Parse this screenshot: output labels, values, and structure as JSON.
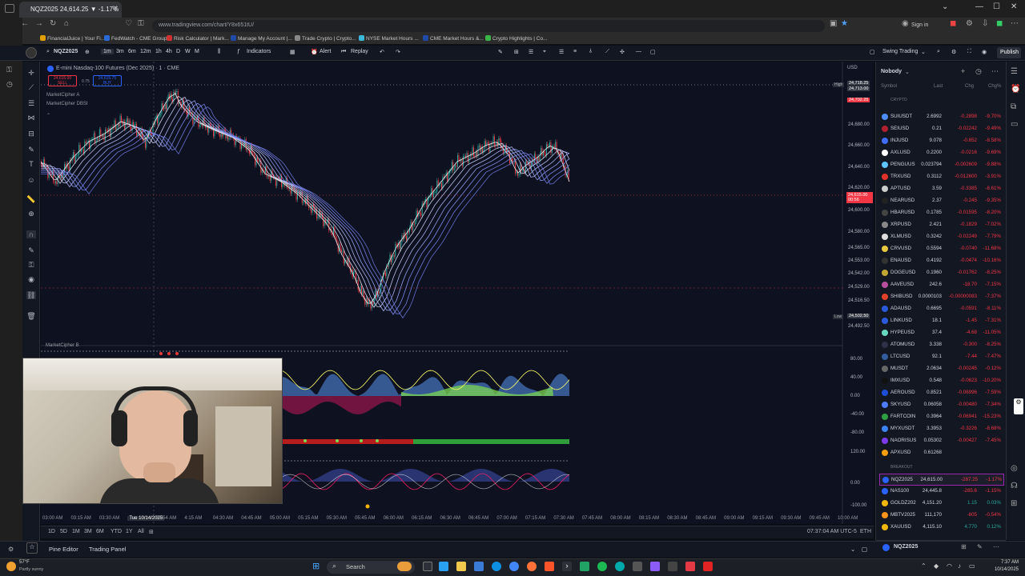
{
  "browser": {
    "tab_title": "NQZ2025 24,614.25 ▼ -1.17%",
    "url": "www.tradingview.com/chart/Y8x651tU/",
    "sign_in": "Sign in",
    "bookmarks": [
      "FinancialJuice | Your Fi...",
      "FedWatch - CME Group",
      "Risk Calculator | Mark...",
      "Manage My Account |...",
      "Trade Crypto | Crypto...",
      "NYSE Market Hours ...",
      "CME Market Hours &...",
      "Crypto Highlights | Co..."
    ]
  },
  "header": {
    "symbol": "NQZ2025",
    "intervals": [
      "1m",
      "3m",
      "6m",
      "12m",
      "1h",
      "4h",
      "D",
      "W",
      "M"
    ],
    "indicators_label": "Indicators",
    "alert_label": "Alert",
    "replay_label": "Replay",
    "layout_name": "Swing Trading",
    "publish_label": "Publish"
  },
  "chart": {
    "title": "E-mini Nasdaq-100 Futures (Dec 2025) · 1 · CME",
    "sell_price": "24,615.00",
    "sell_label": "SELL",
    "spread": "0.75",
    "buy_price": "24,615.75",
    "buy_label": "BUY",
    "indicator_a": "MarketCipher A",
    "indicator_dbsi": "MarketCipher DBSI",
    "indicator_b": "MarketCipher B",
    "currency": "USD",
    "price_labels": [
      "24,680.00",
      "24,660.00",
      "24,640.00",
      "24,620.00",
      "24,600.00",
      "24,580.00",
      "24,565.00",
      "24,553.00",
      "24,542.00",
      "24,529.00",
      "24,516.50",
      "24,492.50"
    ],
    "high_label": "High",
    "high_value": "24,718.25",
    "high_value2": "24,713.00",
    "current_price": "24,702.25",
    "last_price": "24,615.00",
    "last_countdown": "00:56",
    "low_label": "Low",
    "low_value": "24,502.50",
    "osc_labels": [
      "80.00",
      "40.00",
      "0.00",
      "-40.00",
      "-80.00",
      "120.00",
      "0.00",
      "-100.00"
    ],
    "time_labels": [
      "03:00 AM",
      "03:15 AM",
      "03:30 AM",
      "Tue 10/14/2025",
      "03:54 AM",
      "4:15 AM",
      "04:30 AM",
      "04:45 AM",
      "05:00 AM",
      "05:15 AM",
      "05:30 AM",
      "05:45 AM",
      "06:00 AM",
      "06:15 AM",
      "06:30 AM",
      "06:45 AM",
      "07:00 AM",
      "07:15 AM",
      "07:30 AM",
      "07:45 AM",
      "08:00 AM",
      "08:15 AM",
      "08:30 AM",
      "08:45 AM",
      "09:00 AM",
      "09:15 AM",
      "09:30 AM",
      "09:45 AM",
      "10:00 AM"
    ],
    "ranges": [
      "1D",
      "5D",
      "1M",
      "3M",
      "6M",
      "YTD",
      "1Y",
      "All"
    ],
    "clock": "07:37:04 AM UTC-5",
    "eth": "ETH"
  },
  "bottom": {
    "pine_editor": "Pine Editor",
    "trading_panel": "Trading Panel"
  },
  "watchlist": {
    "name": "Nobody",
    "columns": [
      "Symbol",
      "Last",
      "Chg",
      "Chg%"
    ],
    "section_crypto": "CRYPTO",
    "section_breakout": "BREAKOUT",
    "footer_symbol": "NQZ2025",
    "rows": [
      {
        "s": "SUIUSDT",
        "l": "2.6992",
        "c": "-0.2898",
        "p": "-9.70%",
        "col": "#4c8dff"
      },
      {
        "s": "SEIUSD",
        "l": "0.21",
        "c": "-0.02242",
        "p": "-9.49%",
        "col": "#b02030"
      },
      {
        "s": "INJUSD",
        "l": "9.078",
        "c": "-0.852",
        "p": "-8.58%",
        "col": "#3d6cff"
      },
      {
        "s": "AXLUSD",
        "l": "0.2200",
        "c": "-0.0216",
        "p": "-9.69%",
        "col": "#ffffff"
      },
      {
        "s": "PENGUUS",
        "l": "0.023794",
        "c": "-0.002609",
        "p": "-9.88%",
        "col": "#5fc5ff"
      },
      {
        "s": "TRXUSD",
        "l": "0.3112",
        "c": "-0.012600",
        "p": "-3.91%",
        "col": "#e0312a"
      },
      {
        "s": "APTUSD",
        "l": "3.59",
        "c": "-0.3385",
        "p": "-8.61%",
        "col": "#cccccc"
      },
      {
        "s": "NEARUSD",
        "l": "2.37",
        "c": "-0.245",
        "p": "-9.35%",
        "col": "#222222"
      },
      {
        "s": "HBARUSD",
        "l": "0.1785",
        "c": "-0.01595",
        "p": "-8.20%",
        "col": "#444444"
      },
      {
        "s": "XRPUSD",
        "l": "2.421",
        "c": "-0.1829",
        "p": "-7.02%",
        "col": "#888888"
      },
      {
        "s": "XLMUSD",
        "l": "0.3242",
        "c": "-0.02249",
        "p": "-7.79%",
        "col": "#dddddd"
      },
      {
        "s": "CRVUSD",
        "l": "0.5594",
        "c": "-0.0740",
        "p": "-11.68%",
        "col": "#e8c840"
      },
      {
        "s": "ENAUSD",
        "l": "0.4192",
        "c": "-0.0474",
        "p": "-10.16%",
        "col": "#333333"
      },
      {
        "s": "DOGEUSD",
        "l": "0.1960",
        "c": "-0.01762",
        "p": "-8.25%",
        "col": "#c2a633"
      },
      {
        "s": "AAVEUSD",
        "l": "242.6",
        "c": "-18.70",
        "p": "-7.15%",
        "col": "#b6509e"
      },
      {
        "s": "SHIBUSD",
        "l": "0.0000103",
        "c": "-0.00000083",
        "p": "-7.37%",
        "col": "#e0412a"
      },
      {
        "s": "ADAUSD",
        "l": "0.6695",
        "c": "-0.0591",
        "p": "-8.11%",
        "col": "#2a5ada"
      },
      {
        "s": "LINKUSD",
        "l": "18.1",
        "c": "-1.45",
        "p": "-7.31%",
        "col": "#2a5ada"
      },
      {
        "s": "HYPEUSD",
        "l": "37.4",
        "c": "-4.68",
        "p": "-11.05%",
        "col": "#66d9c0"
      },
      {
        "s": "ATOMUSD",
        "l": "3.338",
        "c": "-0.300",
        "p": "-8.25%",
        "col": "#2e3148"
      },
      {
        "s": "LTCUSD",
        "l": "92.1",
        "c": "-7.44",
        "p": "-7.47%",
        "col": "#345d9d"
      },
      {
        "s": "MUSDT",
        "l": "2.0634",
        "c": "-0.00245",
        "p": "-0.12%",
        "col": "#666666"
      },
      {
        "s": "IMXUSD",
        "l": "0.548",
        "c": "-0.0623",
        "p": "-10.20%",
        "col": "#111111"
      },
      {
        "s": "AEROUSD",
        "l": "0.8521",
        "c": "-0.06996",
        "p": "-7.59%",
        "col": "#1d4ed8"
      },
      {
        "s": "SKYUSD",
        "l": "0.06058",
        "c": "-0.00480",
        "p": "-7.34%",
        "col": "#4f7cff"
      },
      {
        "s": "FARTCOIN",
        "l": "0.3964",
        "c": "-0.06941",
        "p": "-15.23%",
        "col": "#2ea043"
      },
      {
        "s": "MYXUSDT",
        "l": "3.3953",
        "c": "-0.3226",
        "p": "-8.68%",
        "col": "#3b82f6"
      },
      {
        "s": "NAORISUS",
        "l": "0.05302",
        "c": "-0.00427",
        "p": "-7.45%",
        "col": "#7c3aed"
      },
      {
        "s": "APXUSD",
        "l": "0.61268",
        "c": "",
        "p": "",
        "col": "#f59e0b"
      }
    ],
    "breakout_rows": [
      {
        "s": "NQZ2025",
        "l": "24,615.00",
        "c": "-287.25",
        "p": "-1.17%",
        "col": "#2962ff"
      },
      {
        "s": "NAS100",
        "l": "24,445.8",
        "c": "-285.6",
        "p": "-1.15%",
        "col": "#2962ff"
      },
      {
        "s": "GOLDZ2025",
        "l": "4,151.20",
        "c": "1.15",
        "p": "0.03%",
        "col": "#f0b90b"
      },
      {
        "s": "MBTV2025",
        "l": "111,170",
        "c": "-605",
        "p": "-0.54%",
        "col": "#f7931a"
      },
      {
        "s": "XAUUSD",
        "l": "4,115.10",
        "c": "4.770",
        "p": "0.12%",
        "col": "#f0b90b"
      }
    ]
  },
  "taskbar": {
    "weather_temp": "57°F",
    "weather_desc": "Partly sunny",
    "search_label": "Search",
    "time": "7:37 AM",
    "date": "10/14/2025"
  },
  "colors": {
    "up": "#26a69a",
    "down": "#f23645",
    "accent": "#2962ff"
  }
}
